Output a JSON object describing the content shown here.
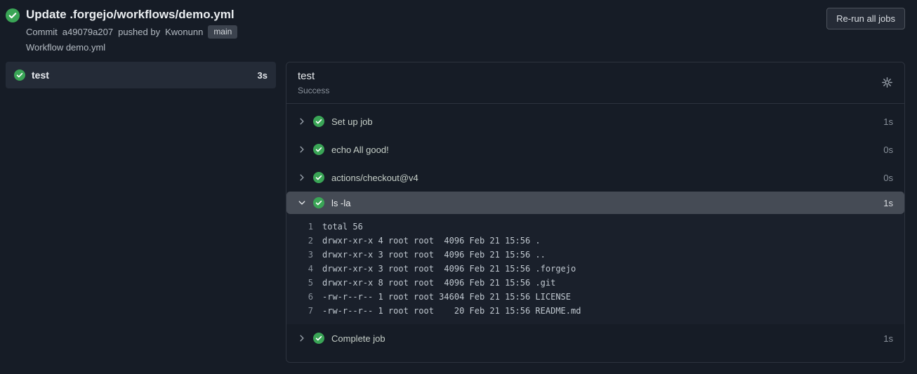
{
  "header": {
    "status_icon": "check-circle",
    "title": "Update .forgejo/workflows/demo.yml",
    "commit_prefix": "Commit",
    "commit_sha": "a49079a207",
    "commit_middle": "pushed by",
    "commit_author": "Kwonunn",
    "branch": "main",
    "workflow_line": "Workflow demo.yml",
    "rerun_button": "Re-run all jobs"
  },
  "sidebar": {
    "jobs": [
      {
        "name": "test",
        "duration": "3s",
        "status": "success",
        "selected": true
      }
    ]
  },
  "job_panel": {
    "title": "test",
    "status": "Success",
    "gear_icon": "gear",
    "steps": [
      {
        "label": "Set up job",
        "duration": "1s",
        "status": "success",
        "expanded": false
      },
      {
        "label": "echo All good!",
        "duration": "0s",
        "status": "success",
        "expanded": false
      },
      {
        "label": "actions/checkout@v4",
        "duration": "0s",
        "status": "success",
        "expanded": false
      },
      {
        "label": "ls -la",
        "duration": "1s",
        "status": "success",
        "expanded": true,
        "log_lines": [
          {
            "num": "1",
            "text": "total 56"
          },
          {
            "num": "2",
            "text": "drwxr-xr-x 4 root root  4096 Feb 21 15:56 ."
          },
          {
            "num": "3",
            "text": "drwxr-xr-x 3 root root  4096 Feb 21 15:56 .."
          },
          {
            "num": "4",
            "text": "drwxr-xr-x 3 root root  4096 Feb 21 15:56 .forgejo"
          },
          {
            "num": "5",
            "text": "drwxr-xr-x 8 root root  4096 Feb 21 15:56 .git"
          },
          {
            "num": "6",
            "text": "-rw-r--r-- 1 root root 34604 Feb 21 15:56 LICENSE"
          },
          {
            "num": "7",
            "text": "-rw-r--r-- 1 root root    20 Feb 21 15:56 README.md"
          }
        ]
      },
      {
        "label": "Complete job",
        "duration": "1s",
        "status": "success",
        "expanded": false
      }
    ]
  },
  "colors": {
    "page_bg": "#161c26",
    "panel_border": "#2d333e",
    "success_green": "#3aa556",
    "selected_step_bg": "#454b55",
    "log_bg": "#1a202b",
    "sidebar_item_bg": "#242b37",
    "badge_bg": "#3c434e"
  }
}
